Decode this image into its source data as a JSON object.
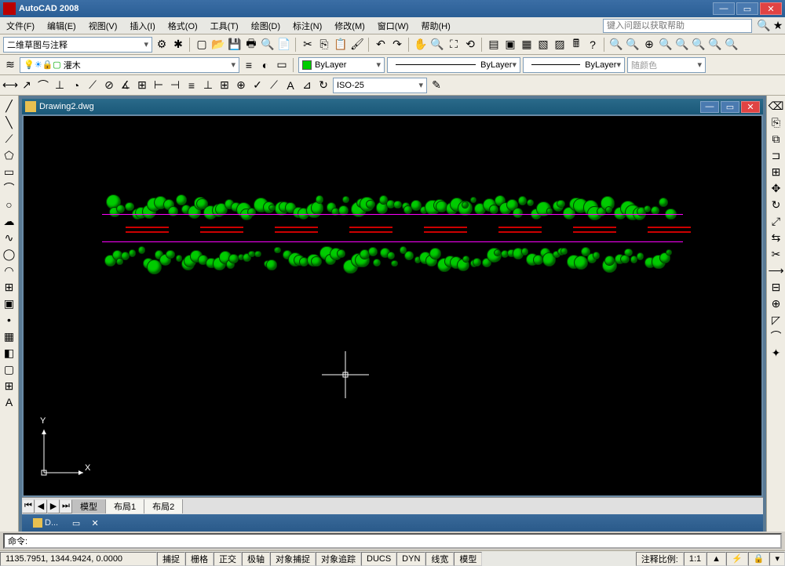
{
  "app": {
    "title": "AutoCAD 2008"
  },
  "menu": [
    "文件(F)",
    "编辑(E)",
    "视图(V)",
    "插入(I)",
    "格式(O)",
    "工具(T)",
    "绘图(D)",
    "标注(N)",
    "修改(M)",
    "窗口(W)",
    "帮助(H)"
  ],
  "help_placeholder": "键入问题以获取帮助",
  "workspace": "二维草图与注释",
  "layer_name": "灌木",
  "bylayer": "ByLayer",
  "dimstyle": "ISO-25",
  "color_label": "随颜色",
  "document": {
    "name": "Drawing2.dwg"
  },
  "tabs": {
    "model": "模型",
    "layout1": "布局1",
    "layout2": "布局2"
  },
  "docbar_name": "D...",
  "command_prompt": "命令:",
  "coords": "1135.7951, 1344.9424, 0.0000",
  "status": [
    "捕捉",
    "栅格",
    "正交",
    "极轴",
    "对象捕捉",
    "对象追踪",
    "DUCS",
    "DYN",
    "线宽",
    "模型"
  ],
  "anno_scale_label": "注释比例:",
  "anno_scale": "1:1",
  "ucs": {
    "x": "X",
    "y": "Y"
  }
}
